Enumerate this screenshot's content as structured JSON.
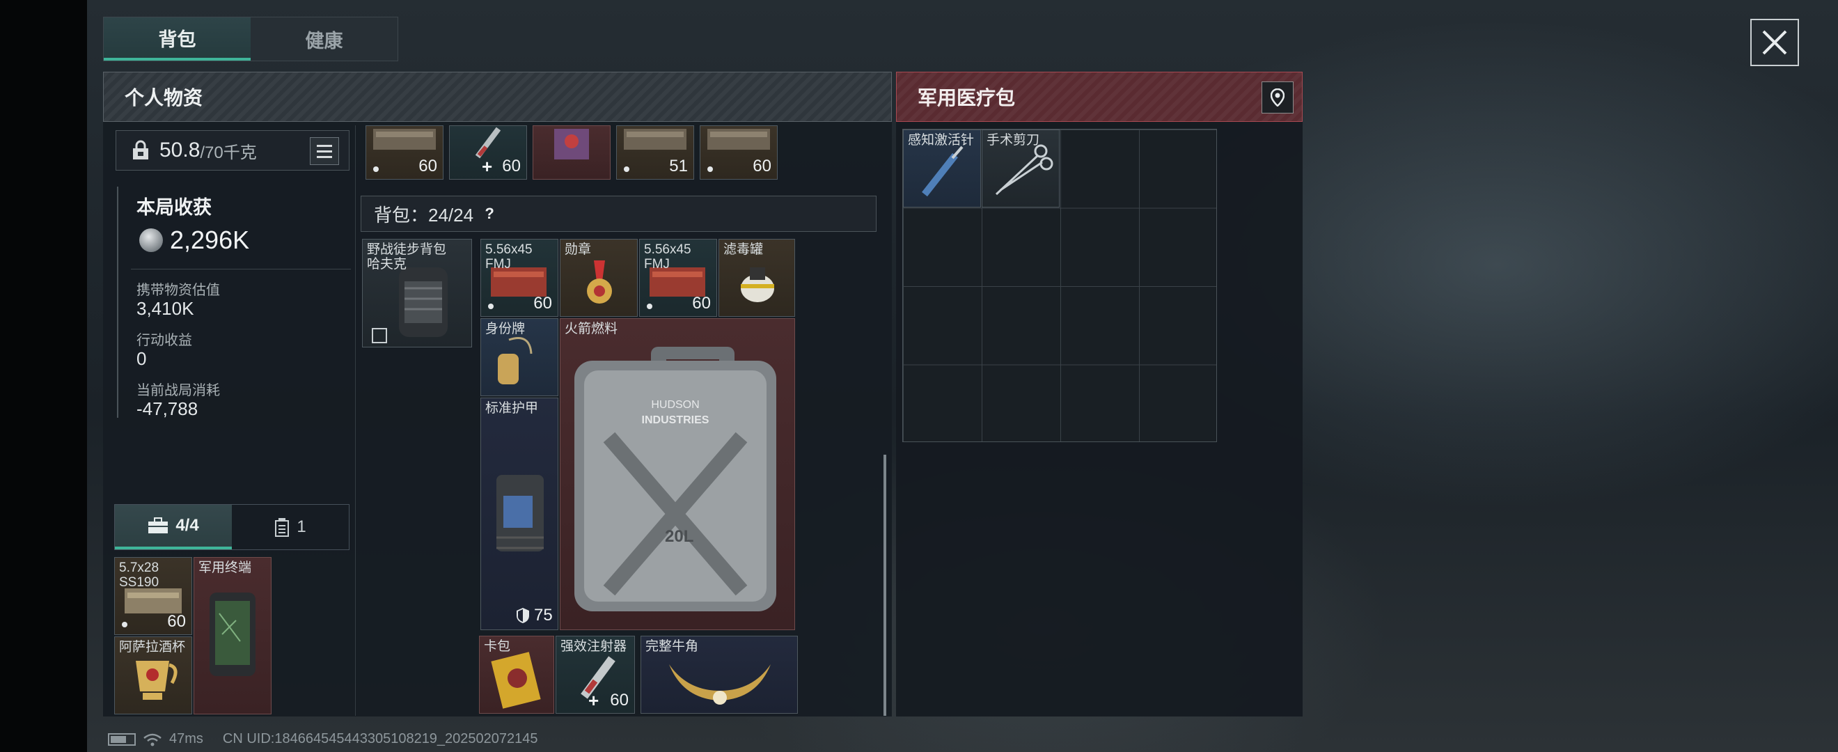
{
  "tabs": [
    {
      "label": "背包",
      "active": true
    },
    {
      "label": "健康",
      "active": false
    }
  ],
  "personal": {
    "title": "个人物资",
    "weight_value": "50.8",
    "weight_max": "/70千克",
    "stats": {
      "heading": "本局收获",
      "total": "2,296K",
      "carry_label": "携带物资估值",
      "carry_value": "3,410K",
      "action_label": "行动收益",
      "action_value": "0",
      "cost_label": "当前战局消耗",
      "cost_value": "-47,788"
    },
    "top_row": [
      {
        "count": "60",
        "mark": "dot"
      },
      {
        "count": "60",
        "mark": "plus"
      },
      {
        "count": "",
        "mark": ""
      },
      {
        "count": "51",
        "mark": "dot"
      },
      {
        "count": "60",
        "mark": "dot"
      }
    ],
    "bag_label": "背包：24/24",
    "help": "?",
    "backpack_name": "野战徒步背包\n哈夫克",
    "items": {
      "ammo1_name": "5.56x45\nFMJ",
      "ammo1_count": "60",
      "medal": "勋章",
      "ammo2_name": "5.56x45\nFMJ",
      "ammo2_count": "60",
      "filter": "滤毒罐",
      "dogtag": "身份牌",
      "fuel": "火箭燃料",
      "armor": "标准护甲",
      "armor_value": "75",
      "card_bag": "卡包",
      "injector": "强效注射器",
      "injector_count": "60",
      "horn": "完整牛角",
      "can_label_top": "HUDSON",
      "can_label_bottom": "INDUSTRIES",
      "can_volume": "20L"
    },
    "sub_tabs": [
      {
        "label": "4/4",
        "active": true,
        "icon": "briefcase-icon"
      },
      {
        "label": "1",
        "active": false,
        "icon": "case-icon"
      }
    ],
    "pouch": {
      "ammo_name": "5.7x28\nSS190",
      "ammo_count": "60",
      "terminal": "军用终端",
      "cup": "阿萨拉酒杯"
    }
  },
  "medical": {
    "title": "军用医疗包",
    "items": [
      {
        "name": "感知激活针"
      },
      {
        "name": "手术剪刀"
      }
    ]
  },
  "status": {
    "ping": "47ms",
    "uid": "CN UID:18466454544330510821​9_202502072145"
  },
  "colors": {
    "accent": "#3fb59a",
    "medical": "#5a2b31"
  }
}
